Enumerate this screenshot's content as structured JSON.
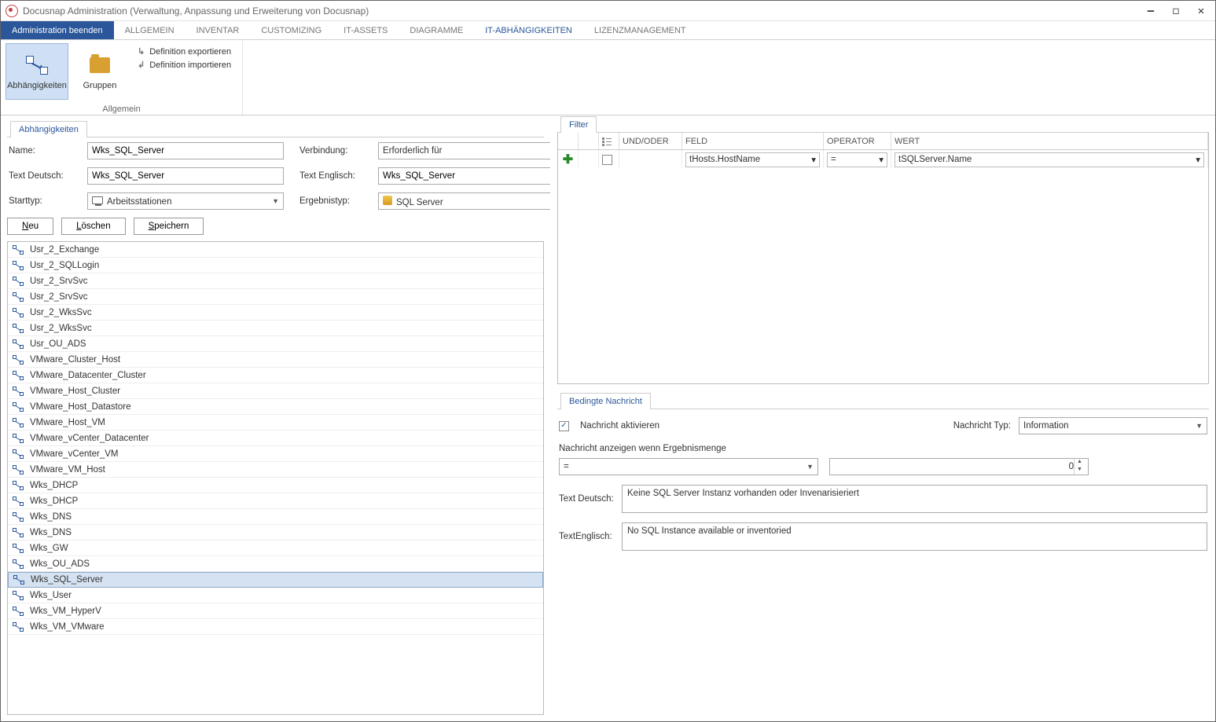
{
  "window": {
    "title": "Docusnap Administration (Verwaltung, Anpassung und Erweiterung von Docusnap)"
  },
  "tabs": {
    "primary": "Administration beenden",
    "items": [
      "ALLGEMEIN",
      "INVENTAR",
      "CUSTOMIZING",
      "IT-ASSETS",
      "DIAGRAMME",
      "IT-ABHÄNGIGKEITEN",
      "LIZENZMANAGEMENT"
    ],
    "active_index": 5
  },
  "ribbon": {
    "dep": "Abhängigkeiten",
    "groups": "Gruppen",
    "export": "Definition exportieren",
    "import": "Definition importieren",
    "group_label": "Allgemein"
  },
  "left": {
    "subtab": "Abhängigkeiten",
    "labels": {
      "name": "Name:",
      "text_de": "Text Deutsch:",
      "starttyp": "Starttyp:",
      "verbindung": "Verbindung:",
      "text_en": "Text Englisch:",
      "ergebnistyp": "Ergebnistyp:"
    },
    "values": {
      "name": "Wks_SQL_Server",
      "text_de": "Wks_SQL_Server",
      "starttyp": "Arbeitsstationen",
      "verbindung": "Erforderlich für",
      "text_en": "Wks_SQL_Server",
      "ergebnistyp": "SQL Server"
    },
    "buttons": {
      "neu_pre": "",
      "neu_ul": "N",
      "neu_post": "eu",
      "loeschen_pre": "",
      "loeschen_ul": "L",
      "loeschen_post": "öschen",
      "speichern_pre": "",
      "speichern_ul": "S",
      "speichern_post": "peichern"
    },
    "list": [
      "Usr_2_Exchange",
      "Usr_2_SQLLogin",
      "Usr_2_SrvSvc",
      "Usr_2_SrvSvc",
      "Usr_2_WksSvc",
      "Usr_2_WksSvc",
      "Usr_OU_ADS",
      "VMware_Cluster_Host",
      "VMware_Datacenter_Cluster",
      "VMware_Host_Cluster",
      "VMware_Host_Datastore",
      "VMware_Host_VM",
      "VMware_vCenter_Datacenter",
      "VMware_vCenter_VM",
      "VMware_VM_Host",
      "Wks_DHCP",
      "Wks_DHCP",
      "Wks_DNS",
      "Wks_DNS",
      "Wks_GW",
      "Wks_OU_ADS",
      "Wks_SQL_Server",
      "Wks_User",
      "Wks_VM_HyperV",
      "Wks_VM_VMware"
    ],
    "selected": "Wks_SQL_Server"
  },
  "right": {
    "filter_tab": "Filter",
    "headers": {
      "und_oder": "UND/ODER",
      "feld": "FELD",
      "operator": "OPERATOR",
      "wert": "WERT"
    },
    "row": {
      "feld": "tHosts.HostName",
      "operator": "=",
      "wert": "tSQLServer.Name"
    },
    "bn": {
      "tab": "Bedingte Nachricht",
      "activate": "Nachricht aktivieren",
      "typ_label": "Nachricht Typ:",
      "typ_value": "Information",
      "cond_label": "Nachricht anzeigen wenn Ergebnismenge",
      "cond_op": "=",
      "cond_val": "0",
      "de_label": "Text Deutsch:",
      "de_val": "Keine SQL Server Instanz vorhanden oder Invenarisieriert",
      "en_label": "TextEnglisch:",
      "en_val": "No SQL Instance available or inventoried"
    }
  }
}
